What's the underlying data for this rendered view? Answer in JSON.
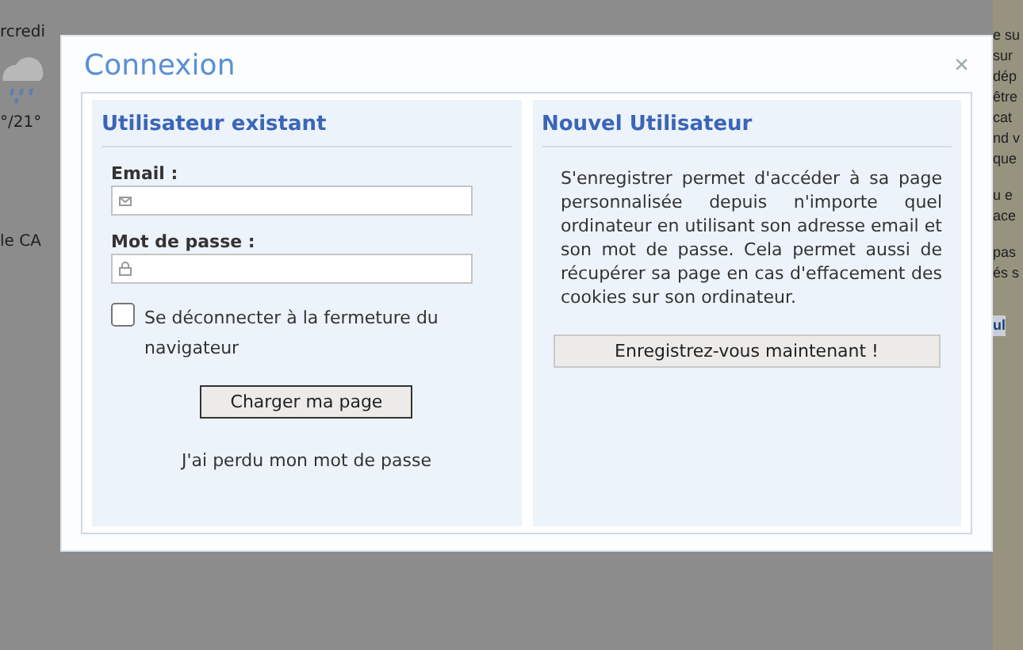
{
  "background": {
    "left_texts": [
      "rcredi",
      "°/21°",
      "le CA"
    ],
    "right_texts": [
      "e su",
      "sur",
      "dép",
      "être",
      "cat",
      "nd v",
      "que",
      "u e",
      "ace",
      "pas",
      "és s",
      "ul"
    ]
  },
  "dialog": {
    "title": "Connexion",
    "close": "×",
    "existing_user": {
      "heading": "Utilisateur existant",
      "email_label": "Email :",
      "password_label": "Mot de passe :",
      "logout_checkbox": {
        "label": "Se déconnecter à la fermeture du navigateur",
        "checked": false
      },
      "submit": "Charger ma page",
      "forgot_link": "J'ai perdu mon mot de passe"
    },
    "new_user": {
      "heading": "Nouvel Utilisateur",
      "description": "S'enregistrer permet d'accéder à sa page personnalisée depuis n'importe quel ordinateur en utilisant son adresse email et son mot de passe. Cela permet aussi de récupérer sa page en cas d'effacement des cookies sur son ordinateur.",
      "register": "Enregistrez-vous maintenant !"
    }
  }
}
